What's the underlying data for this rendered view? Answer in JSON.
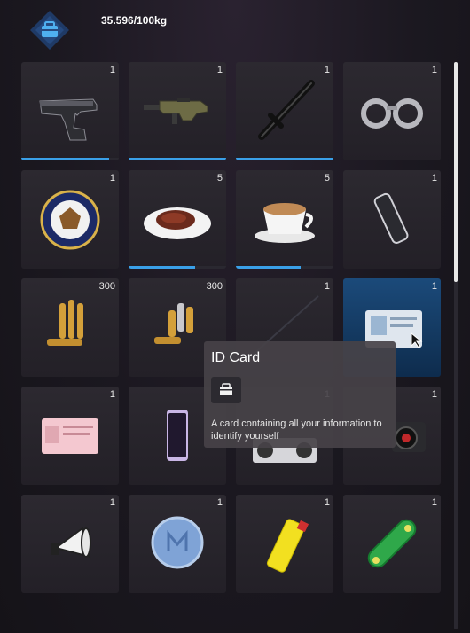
{
  "header": {
    "weight_text": "35.596/100kg",
    "icon": "backpack-icon"
  },
  "colors": {
    "accent": "#3aa0e8",
    "selected": "#1b4a7a"
  },
  "inventory": {
    "slots": [
      {
        "item": "pistol-icon",
        "count": "1",
        "durability": 0.9
      },
      {
        "item": "rifle-icon",
        "count": "1",
        "durability": 1.0
      },
      {
        "item": "baton-icon",
        "count": "1",
        "durability": 1.0
      },
      {
        "item": "handcuffs-icon",
        "count": "1"
      },
      {
        "item": "police-badge-icon",
        "count": "1"
      },
      {
        "item": "steak-icon",
        "count": "5",
        "durability": 0.68
      },
      {
        "item": "coffee-icon",
        "count": "5",
        "durability": 0.66
      },
      {
        "item": "powerbank-icon",
        "count": "1"
      },
      {
        "item": "rifle-ammo-icon",
        "count": "300"
      },
      {
        "item": "pistol-ammo-icon",
        "count": "300"
      },
      {
        "item": "fishing-rod-icon",
        "count": "1"
      },
      {
        "item": "id-card-icon",
        "count": "1",
        "selected": true
      },
      {
        "item": "driver-license-icon",
        "count": "1"
      },
      {
        "item": "phone-icon",
        "count": "1"
      },
      {
        "item": "radio-icon",
        "count": "1"
      },
      {
        "item": "camera-icon",
        "count": "1"
      },
      {
        "item": "megaphone-icon",
        "count": "1"
      },
      {
        "item": "pill-icon",
        "count": "1"
      },
      {
        "item": "lighter-icon",
        "count": "1"
      },
      {
        "item": "skateboard-icon",
        "count": "1"
      }
    ]
  },
  "tooltip": {
    "title": "ID Card",
    "icon": "backpack-icon",
    "description": "A card containing all your information to identify yourself"
  },
  "scroll": {
    "position": 0.0
  }
}
